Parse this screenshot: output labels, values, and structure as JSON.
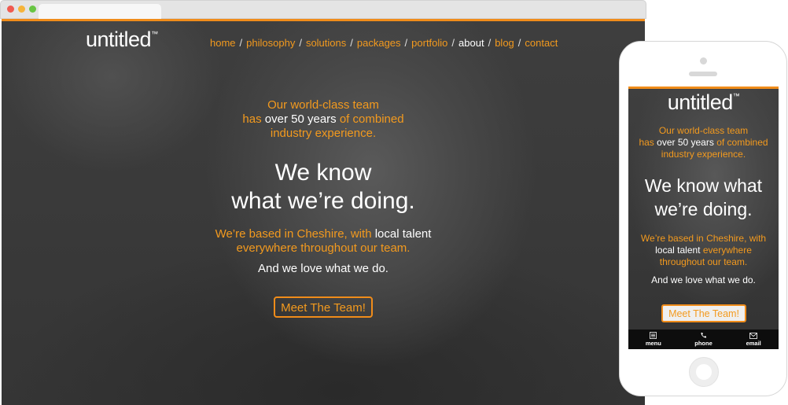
{
  "brand": {
    "name": "untitled",
    "tm": "™"
  },
  "nav": [
    {
      "label": "home",
      "active": false
    },
    {
      "label": "philosophy",
      "active": false
    },
    {
      "label": "solutions",
      "active": false
    },
    {
      "label": "packages",
      "active": false
    },
    {
      "label": "portfolio",
      "active": false
    },
    {
      "label": "about",
      "active": true
    },
    {
      "label": "blog",
      "active": false
    },
    {
      "label": "contact",
      "active": false
    }
  ],
  "nav_separator": "/",
  "hero": {
    "tagline_1": "Our world-class team",
    "tagline_2a": "has",
    "tagline_2b": "over 50 years",
    "tagline_2c": "of combined",
    "tagline_3": "industry experience.",
    "headline_1": "We know",
    "headline_2": "what we’re doing.",
    "location_1a": "We’re based in Cheshire, with",
    "location_1b": "local talent",
    "location_2": "everywhere throughout our team.",
    "love": "And we love what we do.",
    "cta": "Meet The Team!"
  },
  "mobile": {
    "headline_1": "We know what",
    "headline_2": "we’re doing.",
    "location_1": "We’re based in Cheshire, with",
    "location_2a": "local talent",
    "location_2b": "everywhere",
    "location_3": "throughout our team.",
    "bar": [
      {
        "label": "menu",
        "icon": "menu-icon"
      },
      {
        "label": "phone",
        "icon": "phone-icon"
      },
      {
        "label": "email",
        "icon": "email-icon"
      }
    ]
  },
  "colors": {
    "accent": "#f08c1a",
    "text_accent": "#f39a1e",
    "bg": "#3b3b3b",
    "white": "#ffffff"
  }
}
